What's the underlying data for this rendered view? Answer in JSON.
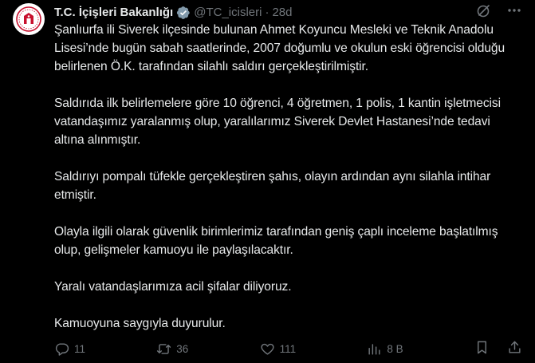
{
  "author": {
    "display_name": "T.C. İçişleri Bakanlığı",
    "handle": "@TC_icisleri",
    "separator": "·",
    "time": "28d"
  },
  "tweet": {
    "paragraphs": [
      "Şanlıurfa ili Siverek ilçesinde bulunan Ahmet Koyuncu Mesleki ve Teknik Anadolu Lisesi’nde bugün sabah saatlerinde, 2007 doğumlu ve okulun eski öğrencisi olduğu belirlenen Ö.K. tarafından silahlı saldırı gerçekleştirilmiştir.",
      "Saldırıda ilk belirlemelere göre 10 öğrenci, 4 öğretmen, 1 polis, 1 kantin işletmecisi vatandaşımız yaralanmış olup, yaralılarımız Siverek Devlet Hastanesi’nde tedavi altına alınmıştır.",
      "Saldırıyı pompalı tüfekle gerçekleştiren şahıs, olayın ardından aynı silahla intihar etmiştir.",
      "Olayla ilgili olarak güvenlik birimlerimiz tarafından geniş çaplı inceleme başlatılmış olup, gelişmeler kamuoyu ile paylaşılacaktır.",
      "Yaralı vatandaşlarımıza acil şifalar diliyoruz.",
      "Kamuoyuna saygıyla duyurulur."
    ]
  },
  "metrics": {
    "replies": "11",
    "reposts": "36",
    "likes": "111",
    "views": "8 B"
  },
  "icons": {
    "verified": "verified-badge-icon",
    "grok": "grok-icon",
    "more": "more-icon",
    "reply": "reply-icon",
    "repost": "repost-icon",
    "like": "like-icon",
    "views": "views-icon",
    "bookmark": "bookmark-icon",
    "share": "share-icon"
  },
  "colors": {
    "background": "#000000",
    "text": "#e7e9ea",
    "secondary": "#71767b",
    "verified_gray": "#829aab",
    "logo_red": "#c8102e"
  }
}
